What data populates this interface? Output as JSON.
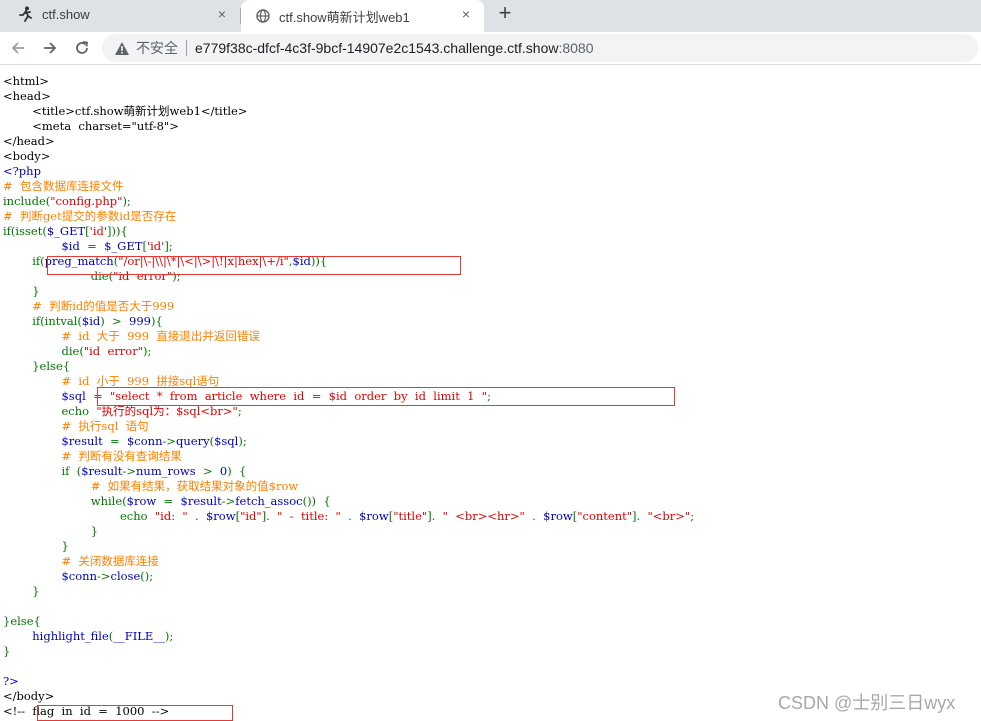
{
  "browser": {
    "tabs": [
      {
        "title": "ctf.show",
        "icon": "ctfshow-runner-icon"
      },
      {
        "title": "ctf.show萌新计划web1",
        "icon": "globe-icon",
        "active": true
      }
    ],
    "new_tab": "+",
    "close_glyph": "×",
    "address": {
      "security_label": "不安全",
      "host": "e779f38c-dfcf-4c3f-9bcf-14907e2c1543.challenge.ctf.show",
      "port": ":8080"
    }
  },
  "source_lines": [
    [
      {
        "c": "blk",
        "t": "<html>"
      }
    ],
    [
      {
        "c": "blk",
        "t": "<head>"
      }
    ],
    [
      {
        "c": "blk",
        "t": "        <title>ctf.show萌新计划web1</title>"
      }
    ],
    [
      {
        "c": "blk",
        "t": "        <meta  charset=\"utf-8\">"
      }
    ],
    [
      {
        "c": "blk",
        "t": "</head>"
      }
    ],
    [
      {
        "c": "blk",
        "t": "<body>"
      }
    ],
    [
      {
        "c": "df",
        "t": "<?php"
      }
    ],
    [
      {
        "c": "cm",
        "t": "#  包含数据库连接文件"
      }
    ],
    [
      {
        "c": "kw",
        "t": "include("
      },
      {
        "c": "st",
        "t": "\"config.php\""
      },
      {
        "c": "kw",
        "t": ");"
      }
    ],
    [
      {
        "c": "cm",
        "t": "#  判断get提交的参数id是否存在"
      }
    ],
    [
      {
        "c": "kw",
        "t": "if(isset("
      },
      {
        "c": "df",
        "t": "$_GET"
      },
      {
        "c": "kw",
        "t": "["
      },
      {
        "c": "st",
        "t": "'id'"
      },
      {
        "c": "kw",
        "t": "])){"
      }
    ],
    [
      {
        "c": "df",
        "t": "                $id  "
      },
      {
        "c": "kw",
        "t": "=  "
      },
      {
        "c": "df",
        "t": "$_GET"
      },
      {
        "c": "kw",
        "t": "["
      },
      {
        "c": "st",
        "t": "'id'"
      },
      {
        "c": "kw",
        "t": "];"
      }
    ],
    [
      {
        "c": "kw",
        "t": "        if("
      },
      {
        "c": "df",
        "t": "preg_match"
      },
      {
        "c": "kw",
        "t": "("
      },
      {
        "c": "st",
        "t": "\"/or|\\-|\\\\|\\*|\\<|\\>|\\!|x|hex|\\+/i\""
      },
      {
        "c": "kw",
        "t": ","
      },
      {
        "c": "df",
        "t": "$id"
      },
      {
        "c": "kw",
        "t": ")){"
      }
    ],
    [
      {
        "c": "kw",
        "t": "                        die("
      },
      {
        "c": "st",
        "t": "\"id  error\""
      },
      {
        "c": "kw",
        "t": ");"
      }
    ],
    [
      {
        "c": "kw",
        "t": "        }"
      }
    ],
    [
      {
        "c": "cm",
        "t": "        #  判断id的值是否大于999"
      }
    ],
    [
      {
        "c": "kw",
        "t": "        if(intval("
      },
      {
        "c": "df",
        "t": "$id"
      },
      {
        "c": "kw",
        "t": ")  >  "
      },
      {
        "c": "df",
        "t": "999"
      },
      {
        "c": "kw",
        "t": "){"
      }
    ],
    [
      {
        "c": "cm",
        "t": "                #  id  大于  999  直接退出并返回错误"
      }
    ],
    [
      {
        "c": "kw",
        "t": "                die("
      },
      {
        "c": "st",
        "t": "\"id  error\""
      },
      {
        "c": "kw",
        "t": ");"
      }
    ],
    [
      {
        "c": "kw",
        "t": "        }else{"
      }
    ],
    [
      {
        "c": "cm",
        "t": "                #  id  小于  999  拼接sql语句"
      }
    ],
    [
      {
        "c": "df",
        "t": "                $sql  "
      },
      {
        "c": "kw",
        "t": "=  "
      },
      {
        "c": "st",
        "t": "\"select  *  from  article  where  id  =  $id  order  by  id  limit  1  \""
      },
      {
        "c": "kw",
        "t": ";"
      }
    ],
    [
      {
        "c": "kw",
        "t": "                echo  "
      },
      {
        "c": "st",
        "t": "\"执行的sql为：$sql<br>\""
      },
      {
        "c": "kw",
        "t": ";"
      }
    ],
    [
      {
        "c": "cm",
        "t": "                #  执行sql  语句"
      }
    ],
    [
      {
        "c": "df",
        "t": "                $result  "
      },
      {
        "c": "kw",
        "t": "=  "
      },
      {
        "c": "df",
        "t": "$conn"
      },
      {
        "c": "kw",
        "t": "->"
      },
      {
        "c": "df",
        "t": "query"
      },
      {
        "c": "kw",
        "t": "("
      },
      {
        "c": "df",
        "t": "$sql"
      },
      {
        "c": "kw",
        "t": ");"
      }
    ],
    [
      {
        "c": "cm",
        "t": "                #  判断有没有查询结果"
      }
    ],
    [
      {
        "c": "kw",
        "t": "                if  ("
      },
      {
        "c": "df",
        "t": "$result"
      },
      {
        "c": "kw",
        "t": "->"
      },
      {
        "c": "df",
        "t": "num_rows  "
      },
      {
        "c": "kw",
        "t": ">  "
      },
      {
        "c": "df",
        "t": "0"
      },
      {
        "c": "kw",
        "t": ")  {"
      }
    ],
    [
      {
        "c": "cm",
        "t": "                        #  如果有结果，获取结果对象的值$row"
      }
    ],
    [
      {
        "c": "kw",
        "t": "                        while("
      },
      {
        "c": "df",
        "t": "$row  "
      },
      {
        "c": "kw",
        "t": "=  "
      },
      {
        "c": "df",
        "t": "$result"
      },
      {
        "c": "kw",
        "t": "->"
      },
      {
        "c": "df",
        "t": "fetch_assoc"
      },
      {
        "c": "kw",
        "t": "())  {"
      }
    ],
    [
      {
        "c": "kw",
        "t": "                                echo  "
      },
      {
        "c": "st",
        "t": "\"id:  \"  "
      },
      {
        "c": "kw",
        "t": ".  "
      },
      {
        "c": "df",
        "t": "$row"
      },
      {
        "c": "kw",
        "t": "["
      },
      {
        "c": "st",
        "t": "\"id\""
      },
      {
        "c": "kw",
        "t": "].  "
      },
      {
        "c": "st",
        "t": "\"  -  title:  \"  "
      },
      {
        "c": "kw",
        "t": ".  "
      },
      {
        "c": "df",
        "t": "$row"
      },
      {
        "c": "kw",
        "t": "["
      },
      {
        "c": "st",
        "t": "\"title\""
      },
      {
        "c": "kw",
        "t": "].  "
      },
      {
        "c": "st",
        "t": "\"  <br><hr>\"  "
      },
      {
        "c": "kw",
        "t": ".  "
      },
      {
        "c": "df",
        "t": "$row"
      },
      {
        "c": "kw",
        "t": "["
      },
      {
        "c": "st",
        "t": "\"content\""
      },
      {
        "c": "kw",
        "t": "].  "
      },
      {
        "c": "st",
        "t": "\"<br>\""
      },
      {
        "c": "kw",
        "t": ";"
      }
    ],
    [
      {
        "c": "kw",
        "t": "                        }"
      }
    ],
    [
      {
        "c": "kw",
        "t": "                }"
      }
    ],
    [
      {
        "c": "cm",
        "t": "                #  关闭数据库连接"
      }
    ],
    [
      {
        "c": "df",
        "t": "                $conn"
      },
      {
        "c": "kw",
        "t": "->"
      },
      {
        "c": "df",
        "t": "close"
      },
      {
        "c": "kw",
        "t": "();"
      }
    ],
    [
      {
        "c": "kw",
        "t": "        }"
      }
    ],
    [
      {
        "c": "kw",
        "t": ""
      }
    ],
    [
      {
        "c": "kw",
        "t": "}else{"
      }
    ],
    [
      {
        "c": "kw",
        "t": "        "
      },
      {
        "c": "df",
        "t": "highlight_file"
      },
      {
        "c": "kw",
        "t": "("
      },
      {
        "c": "df",
        "t": "__FILE__"
      },
      {
        "c": "kw",
        "t": ");"
      }
    ],
    [
      {
        "c": "kw",
        "t": "}"
      }
    ],
    [
      {
        "c": "kw",
        "t": ""
      }
    ],
    [
      {
        "c": "df",
        "t": "?>"
      }
    ],
    [
      {
        "c": "blk",
        "t": "</body>"
      }
    ],
    [
      {
        "c": "blk",
        "t": "<!--  flag  in  id  =  1000  -->"
      }
    ]
  ],
  "watermark": "CSDN @士别三日wyx",
  "colors": {
    "tabstrip": "#dee1e6",
    "keyword": "#007700",
    "comment": "#ff8000",
    "string": "#dd0000",
    "default": "#0000bb",
    "highlight_box": "#e53935"
  }
}
